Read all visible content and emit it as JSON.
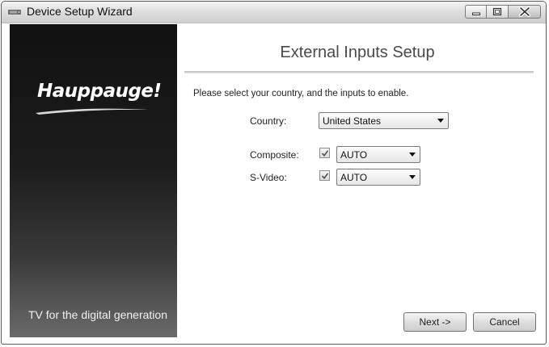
{
  "window": {
    "title": "Device Setup Wizard"
  },
  "sidebar": {
    "brand": "Hauppauge!",
    "tagline": "TV for the digital generation"
  },
  "page": {
    "title": "External Inputs Setup",
    "instruction": "Please select your country, and the inputs to enable."
  },
  "form": {
    "country": {
      "label": "Country:",
      "value": "United States"
    },
    "composite": {
      "label": "Composite:",
      "checked": true,
      "value": "AUTO"
    },
    "svideo": {
      "label": "S-Video:",
      "checked": true,
      "value": "AUTO"
    }
  },
  "buttons": {
    "next": "Next ->",
    "cancel": "Cancel"
  },
  "icons": {
    "app": "tv-tuner-icon",
    "minimize": "minimize-icon",
    "maximize": "maximize-icon",
    "close": "close-icon",
    "dropdown": "chevron-down-icon",
    "check": "checkmark-icon"
  }
}
